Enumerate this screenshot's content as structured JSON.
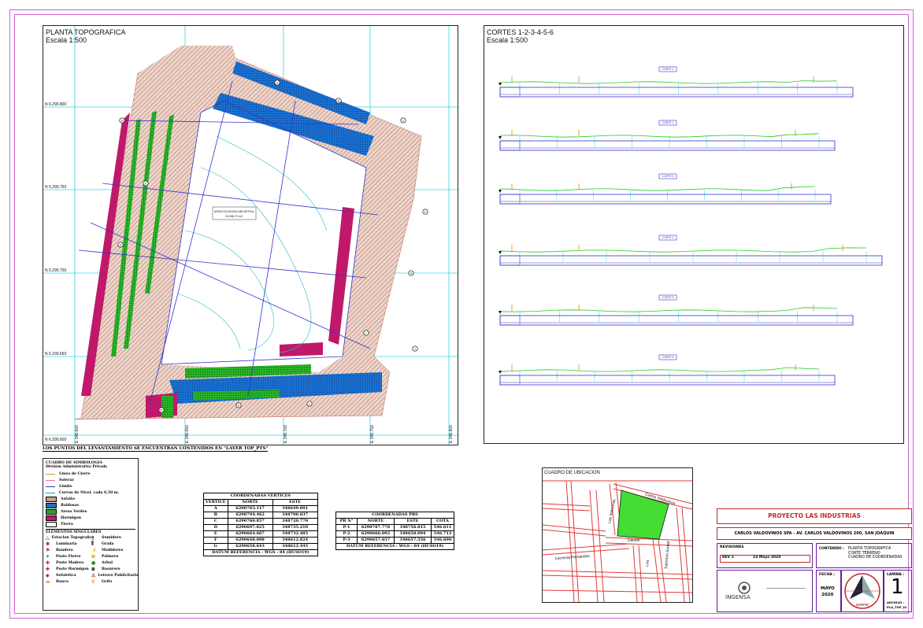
{
  "topo": {
    "title": "PLANTA TOPOGRAFICA",
    "scale": "Escala 1:500",
    "north_labels": [
      "N 6.290.800",
      "N 6.290.750",
      "N 6.290.700",
      "N 6.290.650",
      "N 6.290.600"
    ],
    "east_labels": [
      "E 348.600",
      "E 348.650",
      "E 348.700",
      "E 348.750",
      "E 348.800"
    ],
    "area_label_1": "AREA POLIGONO ABCDEFGA",
    "area_label_2": "15.456,70 m2",
    "vertex_marks": [
      "A",
      "B",
      "C",
      "D",
      "E",
      "F",
      "G",
      "H",
      "I",
      "J",
      "K",
      "L",
      "M"
    ]
  },
  "cortes": {
    "title": "CORTES 1-2-3-4-5-6",
    "scale": "Escala 1:500",
    "section_labels": [
      "CORTE 1",
      "CORTE 2",
      "CORTE 3",
      "CORTE 4",
      "CORTE 5",
      "CORTE 6"
    ]
  },
  "note": "LOS PUNTOS DEL LEVANTAMIENTO SE ENCUENTRAN CONTENIDOS EN \"LAYER TOP_PTS\"",
  "legend": {
    "title": "CUADRO DE SIMBOLOGIA",
    "subtitle": "Division Administrativa Privada",
    "items": [
      {
        "label": "Linea de Cierre",
        "color": "#d4a017",
        "kind": "line"
      },
      {
        "label": "Solerar",
        "color": "#ff66aa",
        "kind": "line"
      },
      {
        "label": "Limite",
        "color": "#3333cc",
        "kind": "line"
      },
      {
        "label": "Curvas de Nivel, cada 0,50 m.",
        "color": "#00aaaa",
        "kind": "line"
      },
      {
        "label": "Asfalto",
        "color": "#c8a08a",
        "kind": "fill"
      },
      {
        "label": "Baldosas",
        "color": "#1a6fd0",
        "kind": "fill"
      },
      {
        "label": "Areas Verdes",
        "color": "#22aa22",
        "kind": "fill"
      },
      {
        "label": "Hormigon",
        "color": "#c0186a",
        "kind": "fill"
      },
      {
        "label": "Tierra",
        "color": "#ffffff",
        "kind": "fill"
      }
    ],
    "singulares_title": "ELEMENTOS SINGULARES",
    "singulares_left": [
      "Estacion Topografica",
      "Luminaria",
      "Bandera",
      "Poste Fierro",
      "Poste Madera",
      "Poste Hormigon",
      "Sefaletica",
      "Banca"
    ],
    "singulares_right": [
      "Sumidero",
      "Grada",
      "Medidores",
      "Palmera",
      "Arbol",
      "Basurero",
      "Letrero Publicitario",
      "Grifo"
    ]
  },
  "vertices_table": {
    "title": "COORDENADAS VERTICES",
    "headers": [
      "VERTICE",
      "NORTE",
      "ESTE"
    ],
    "rows": [
      [
        "A",
        "6290763.117",
        "348649.091"
      ],
      [
        "B",
        "6290794.462",
        "348700.837"
      ],
      [
        "C",
        "6290760.857",
        "348720.770"
      ],
      [
        "D",
        "6290697.825",
        "348735.210"
      ],
      [
        "E",
        "6290664.667",
        "348732.485"
      ],
      [
        "F",
        "6290648.098",
        "348612.824"
      ],
      [
        "G",
        "6290658.643",
        "348612.445"
      ]
    ],
    "datum": "DATUM REFERENCIA : WGS - 84 (HUSO19)"
  },
  "prs_table": {
    "title": "COORDENADAS PRS",
    "headers": [
      "PR N°",
      "NORTE",
      "ESTE",
      "COTA"
    ],
    "rows": [
      [
        "P-1",
        "6290787.778",
        "348756.815",
        "546.611"
      ],
      [
        "P-2",
        "6290666.092",
        "348658.094",
        "546.713"
      ],
      [
        "P-3",
        "6290657.657",
        "348657.556",
        "546.690"
      ]
    ],
    "datum": "DATUM REFERENCIA : WGS - 84 (HUSO19)"
  },
  "ubicacion": {
    "title": "CUADRO DE UBICACION",
    "streets": [
      "Carlos Valdovinos",
      "Las Industrias",
      "Darwin",
      "Lucrecia Fernandez",
      "Lira",
      "Salomon Sumar"
    ]
  },
  "title_block": {
    "project": "PROYECTO LAS INDUSTRIAS",
    "address": "CARLOS VALDOVINOS SPA  -  AV. CARLOS VALDOVINOS 200, SAN JOAQUIN",
    "revisiones_label": "REVISIONES",
    "rev": "REV 1",
    "rev_date": "14 Mayo 2020",
    "contenido_label": "CONTENIDO :",
    "contenido_lines": [
      "PLANTA TOPOGRAFICA",
      "CORTE TERRENO",
      "CUADRO DE COORDENADAS"
    ],
    "fecha_label": "FECHA :",
    "fecha_month": "MAYO",
    "fecha_year": "2020",
    "lamina_label": "LAMINA :",
    "lamina_num": "1",
    "archivo_label": "ARCHIVO :",
    "archivo": "PLA_TOP_LV",
    "norte_label": "NORTE",
    "company": "INGENSA"
  },
  "colors": {
    "frame": "#d65fd6",
    "asphalt": "#c8a08a",
    "concrete": "#c0186a",
    "tiles": "#1a6fd0",
    "green": "#22aa22",
    "grid": "#33d6e6",
    "limit": "#3333cc",
    "title_red": "#c02b2b"
  }
}
